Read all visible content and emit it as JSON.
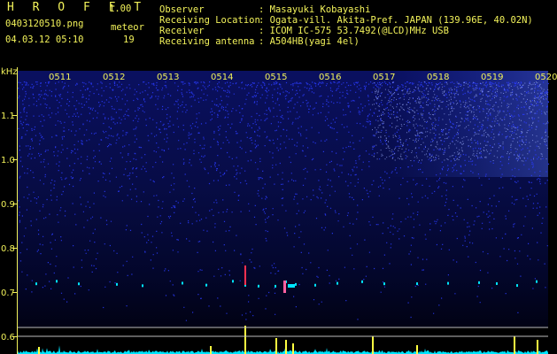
{
  "header": {
    "app_name": "H R O F F T",
    "version": "1.00",
    "filename": "0403120510.png",
    "datetime": "04.03.12 05:10",
    "meteor_label": "meteor",
    "meteor_count": "19",
    "info_labels": [
      "Observer",
      "Receiving Location",
      "Receiver",
      "Receiving antenna"
    ],
    "info_values": [
      ": Masayuki Kobayashi",
      ": Ogata-vill. Akita-Pref. JAPAN (139.96E, 40.02N)",
      ": ICOM IC-575 53.7492(@LCD)MHz USB",
      ": A504HB(yagi 4el)"
    ]
  },
  "spectrogram": {
    "unit_label": "kHz",
    "y_ticks": [
      "1.1",
      "1.0",
      "0.9",
      "0.8",
      "0.7",
      "0.6"
    ],
    "y_tick_values": [
      1.1,
      1.0,
      0.9,
      0.8,
      0.7,
      0.6
    ],
    "x_ticks": [
      "0511",
      "0512",
      "0513",
      "0514",
      "0515",
      "0516",
      "0517",
      "0518",
      "0519",
      "0520"
    ],
    "colors": {
      "axis": "#f2f25a",
      "noise": "#2a3cff",
      "trace": "#00e5ff",
      "meteor": "#ffff40"
    }
  }
}
